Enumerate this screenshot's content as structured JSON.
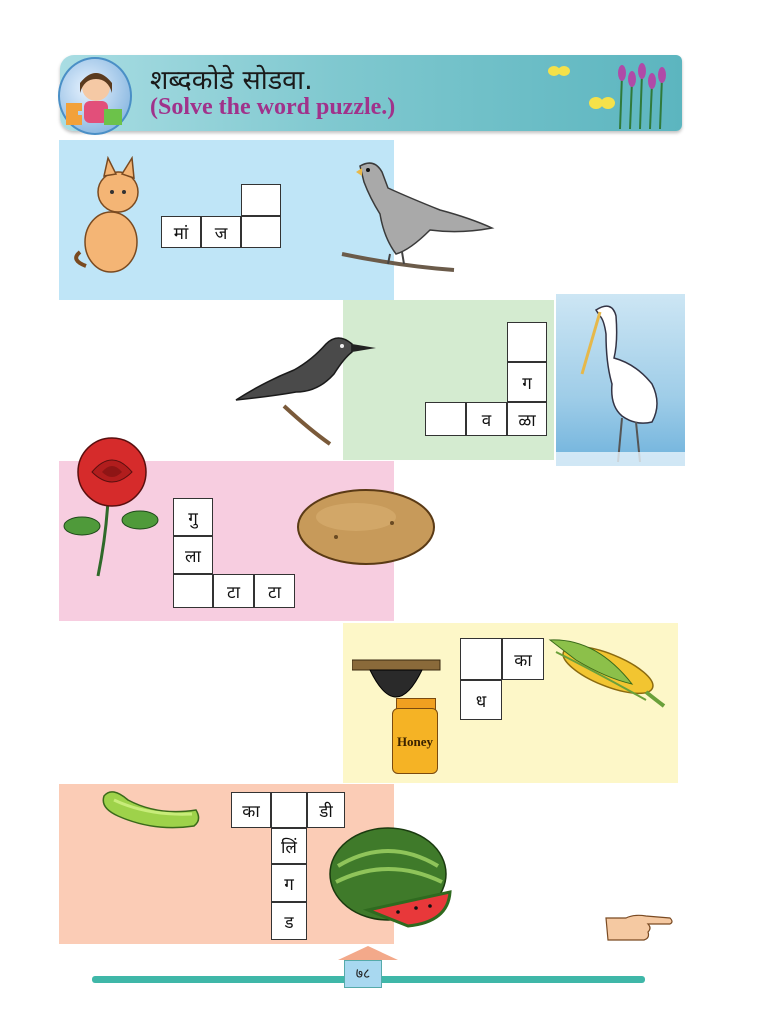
{
  "header": {
    "title_marathi": "शब्दकोडे सोडवा.",
    "title_english": "(Solve the word puzzle.)"
  },
  "puzzles": [
    {
      "row1": [
        "",
        ""
      ],
      "row2": [
        "मां",
        "ज",
        ""
      ]
    },
    {
      "cells": [
        "",
        "ग",
        "",
        "व",
        "ळा"
      ]
    },
    {
      "cells": [
        "गु",
        "ला",
        "",
        "टा",
        "टा"
      ]
    },
    {
      "cells": [
        "",
        "का",
        "ध"
      ]
    },
    {
      "cells": [
        "का",
        "",
        "डी",
        "लिं",
        "ग",
        "ड"
      ]
    }
  ],
  "honey_label": "Honey",
  "page_number": "७८",
  "colors": {
    "blue_panel": "#bfe5f7",
    "green_panel": "#d4ebd0",
    "pink_panel": "#f7cde0",
    "yellow_panel": "#fdf7c8",
    "peach_panel": "#fbccb6",
    "title_english": "#a0328b"
  }
}
